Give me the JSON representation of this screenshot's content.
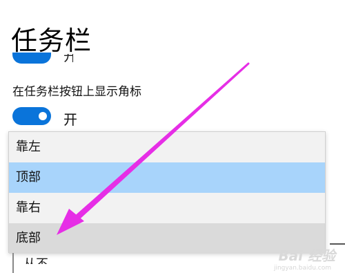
{
  "page": {
    "title": "任务栏"
  },
  "previous_setting": {
    "toggle_on": true,
    "state_label": "开"
  },
  "badge_setting": {
    "label": "在任务栏按钮上显示角标",
    "toggle_on": true,
    "state_label": "开"
  },
  "dropdown": {
    "options": [
      {
        "label": "靠左",
        "state": "normal"
      },
      {
        "label": "顶部",
        "state": "selected"
      },
      {
        "label": "靠右",
        "state": "normal"
      },
      {
        "label": "底部",
        "state": "hover"
      }
    ],
    "below_option_label": "从不"
  },
  "colors": {
    "accent": "#0a74da",
    "selected_bg": "#a8d4fb",
    "hover_bg": "#dadada",
    "arrow": "#e62ee6"
  },
  "watermark": {
    "text": "Bai 经验",
    "sub": "jingyan.baidu.com"
  }
}
